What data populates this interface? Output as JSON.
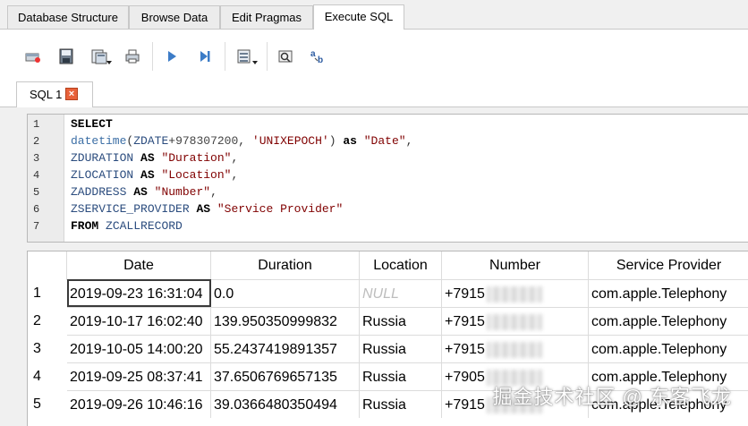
{
  "tabs": [
    "Database Structure",
    "Browse Data",
    "Edit Pragmas",
    "Execute SQL"
  ],
  "active_tab": "Execute SQL",
  "toolbar": {
    "icons": [
      "open-tab-icon",
      "open-sql-file-icon",
      "save-sql-file-icon",
      "print-icon",
      "execute-all-icon",
      "execute-line-icon",
      "save-results-icon",
      "find-icon",
      "find-replace-icon"
    ]
  },
  "editor_tab": {
    "label": "SQL 1",
    "close_label": "×"
  },
  "editor": {
    "line_numbers": [
      "1",
      "2",
      "3",
      "4",
      "5",
      "6",
      "7"
    ]
  },
  "results": {
    "columns": [
      "Date",
      "Duration",
      "Location",
      "Number",
      "Service Provider"
    ],
    "rows": [
      {
        "index": "1",
        "date": "2019-09-23 16:31:04",
        "duration": "0.0",
        "location": "NULL",
        "number": "+7915",
        "provider": "com.apple.Telephony"
      },
      {
        "index": "2",
        "date": "2019-10-17 16:02:40",
        "duration": "139.950350999832",
        "location": "Russia",
        "number": "+7915",
        "provider": "com.apple.Telephony"
      },
      {
        "index": "3",
        "date": "2019-10-05 14:00:20",
        "duration": "55.2437419891357",
        "location": "Russia",
        "number": "+7915",
        "provider": "com.apple.Telephony"
      },
      {
        "index": "4",
        "date": "2019-09-25 08:37:41",
        "duration": "37.6506769657135",
        "location": "Russia",
        "number": "+7905",
        "provider": "com.apple.Telephony"
      },
      {
        "index": "5",
        "date": "2019-09-26 10:46:16",
        "duration": "39.0366480350494",
        "location": "Russia",
        "number": "+7915",
        "provider": "com.apple.Telephony"
      }
    ]
  },
  "watermark": "掘金技术社区 @ 东客飞龙"
}
